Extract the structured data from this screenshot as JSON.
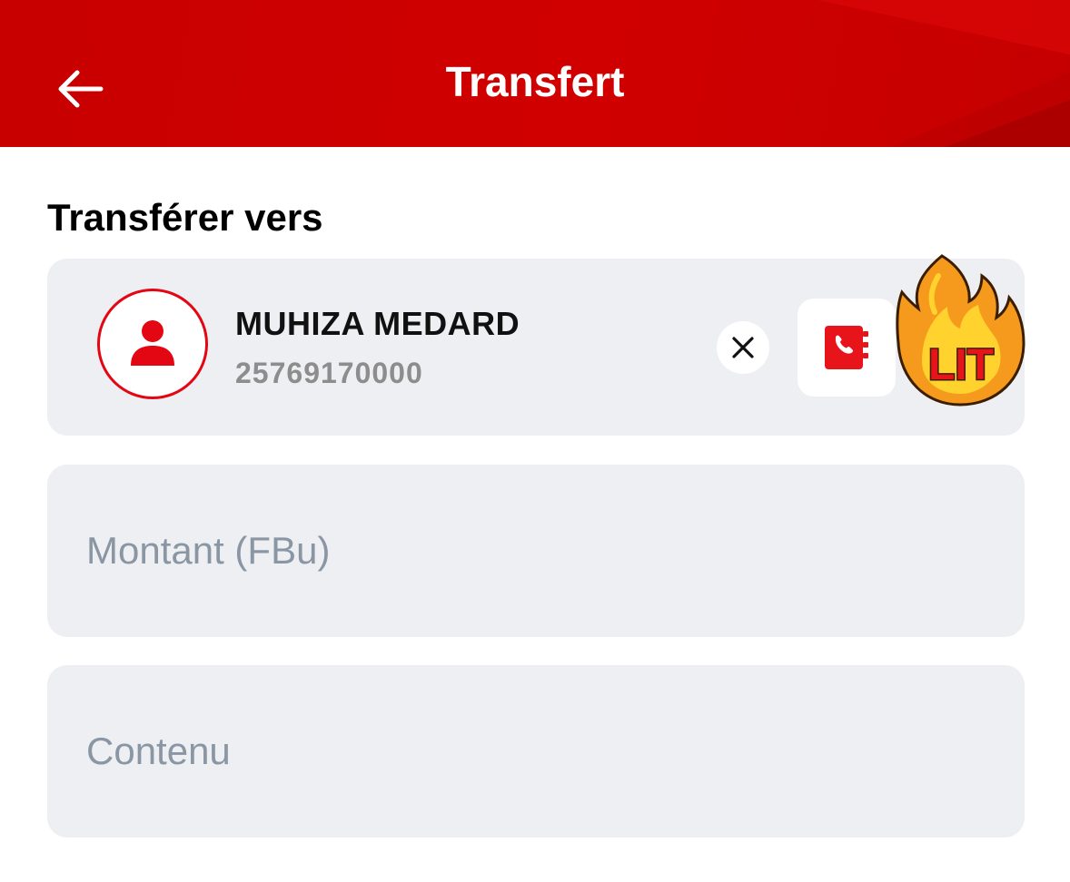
{
  "header": {
    "title": "Transfert",
    "back_icon": "arrow-left-icon",
    "background_color": "#cc0000"
  },
  "section": {
    "title": "Transférer vers"
  },
  "recipient": {
    "name": "MUHIZA MEDARD",
    "phone": "25769170000",
    "avatar_icon": "person-icon",
    "clear_icon": "close-icon",
    "contacts_icon": "contact-book-icon"
  },
  "sticker": {
    "text": "LIT",
    "icon": "fire-icon"
  },
  "form": {
    "amount": {
      "placeholder": "Montant (FBu)",
      "value": ""
    },
    "content": {
      "placeholder": "Contenu",
      "value": ""
    }
  },
  "colors": {
    "brand_red": "#e30613",
    "field_background": "#eeeff2",
    "placeholder": "#8a96a3"
  }
}
